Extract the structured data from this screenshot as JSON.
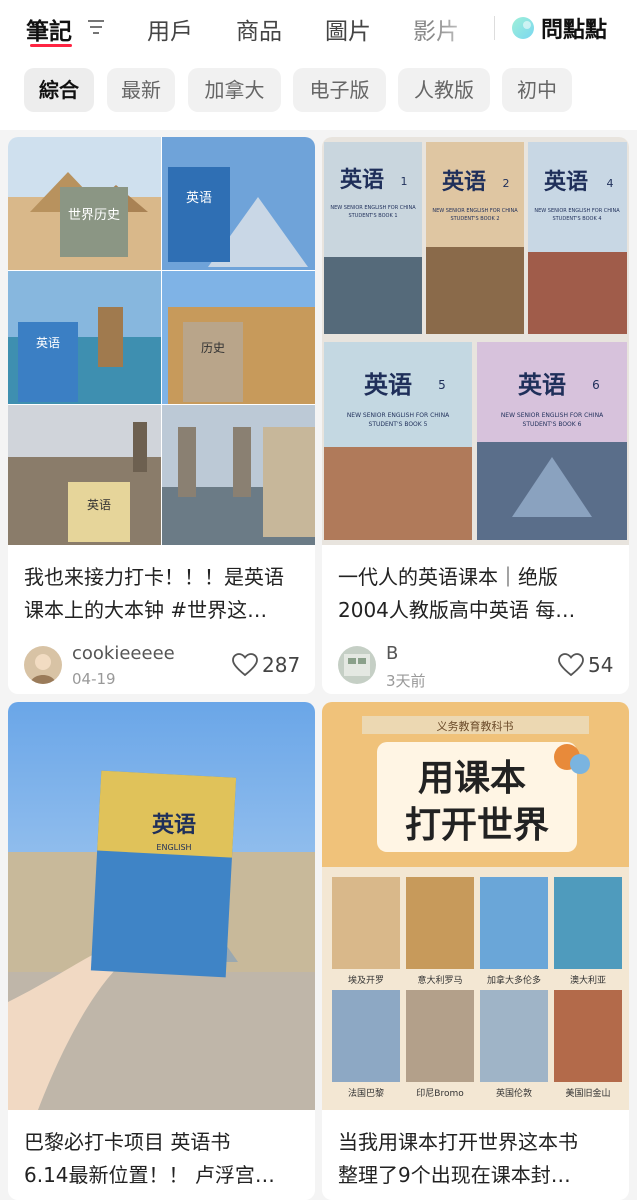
{
  "tabs": {
    "notes": "筆記",
    "users": "用戶",
    "products": "商品",
    "images": "圖片",
    "videos": "影片",
    "ask": "問點點"
  },
  "filters": [
    "綜合",
    "最新",
    "加拿大",
    "电子版",
    "人教版",
    "初中"
  ],
  "cards": [
    {
      "title_line1": "我也来接力打卡！！！是英语",
      "title_line2": "课本上的大本钟 #世界这…",
      "author": "cookieeeee",
      "date": "04-19",
      "likes": "287",
      "image_text": {
        "book1": "世界历史",
        "book2": "英语",
        "book3": "历史",
        "book4": "英语",
        "book5": "英语"
      }
    },
    {
      "title_line1": "一代人的英语课本｜绝版",
      "title_line2": "2004人教版高中英语 每…",
      "author": "B",
      "date": "3天前",
      "likes": "54",
      "image_text": {
        "b1": "英语",
        "b1n": "1",
        "b1s": "STUDENT'S BOOK 1",
        "b2": "英语",
        "b2n": "2",
        "b2s": "STUDENT'S BOOK 2",
        "b3": "英语",
        "b3n": "4",
        "b3s": "STUDENT'S BOOK 4",
        "b4": "英语",
        "b4n": "5",
        "b4s": "STUDENT'S BOOK 5",
        "b5": "英语",
        "b5n": "6",
        "b5s": "STUDENT'S BOOK 6",
        "series": "NEW SENIOR ENGLISH FOR CHINA"
      }
    },
    {
      "title_line1": "巴黎必打卡项目 英语书",
      "title_line2": "6.14最新位置！！ 卢浮宫…",
      "image_text": {
        "book": "英语",
        "sub": "ENGLISH"
      }
    },
    {
      "title_line1": "当我用课本打开世界这本书",
      "title_line2": "整理了9个出现在课本封…",
      "image_text": {
        "banner": "义务教育教科书",
        "headline1": "用课本",
        "headline2": "打开世界",
        "places": [
          "埃及开罗",
          "意大利罗马",
          "加拿大多伦多",
          "澳大利亚",
          "法国巴黎",
          "印尼Bromo",
          "英国伦敦",
          "美国旧金山"
        ]
      }
    }
  ],
  "colors": {
    "accent": "#ff2442"
  }
}
